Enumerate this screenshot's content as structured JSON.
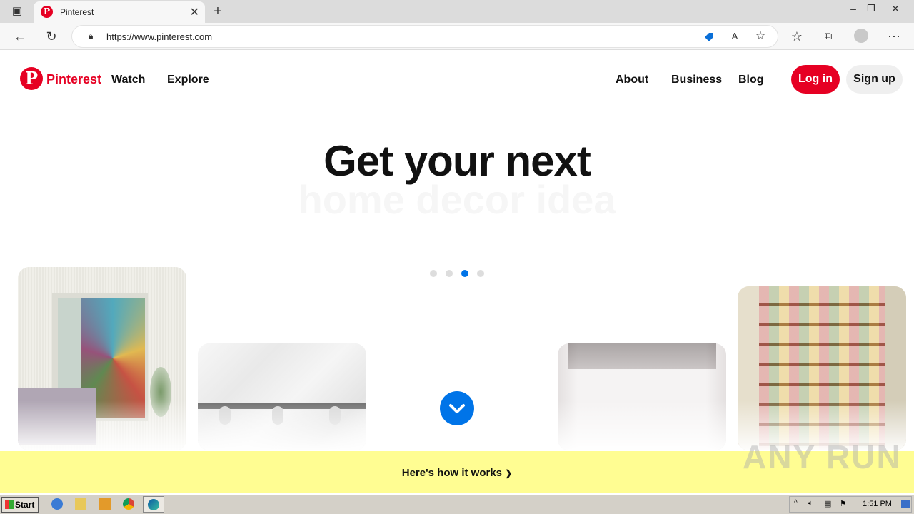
{
  "browser": {
    "tab_title": "Pinterest",
    "url": "https://www.pinterest.com"
  },
  "header": {
    "logo_text": "Pinterest",
    "nav_left": [
      "Watch",
      "Explore"
    ],
    "nav_right": [
      "About",
      "Business",
      "Blog"
    ],
    "login_label": "Log in",
    "signup_label": "Sign up"
  },
  "hero": {
    "headline": "Get your next",
    "subheadline": "home decor idea",
    "carousel_dots": 4,
    "active_dot": 3
  },
  "how_it_works": "Here's how it works",
  "watermark": "ANY RUN",
  "taskbar": {
    "start_label": "Start",
    "clock": "1:51 PM"
  },
  "colors": {
    "brand": "#e60023",
    "accent": "#0074e8",
    "banner": "#fffd92"
  }
}
